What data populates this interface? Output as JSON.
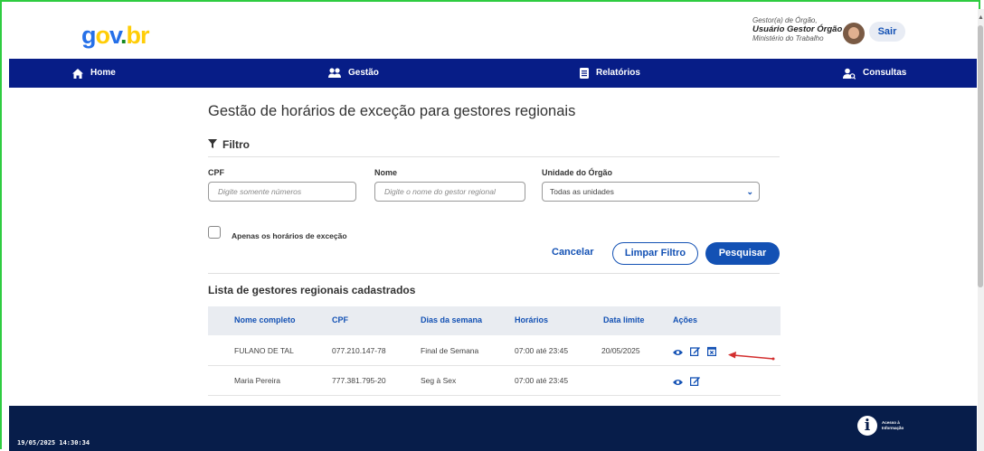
{
  "header": {
    "logo": {
      "g": "g",
      "o": "o",
      "v": "v",
      "dot": ".",
      "br": "br"
    },
    "user": {
      "role": "Gestor(a) de Órgão,",
      "name": "Usuário Gestor Órgão",
      "ministry": "Ministério do Trabalho"
    },
    "logout_label": "Sair"
  },
  "nav": {
    "items": [
      {
        "label": "Home",
        "icon": "home-icon"
      },
      {
        "label": "Gestão",
        "icon": "users-icon"
      },
      {
        "label": "Relatórios",
        "icon": "report-icon"
      },
      {
        "label": "Consultas",
        "icon": "search-user-icon"
      }
    ]
  },
  "page": {
    "title": "Gestão de horários de exceção para gestores regionais"
  },
  "filter": {
    "title": "Filtro",
    "cpf": {
      "label": "CPF",
      "placeholder": "Digite somente números"
    },
    "nome": {
      "label": "Nome",
      "placeholder": "Digite o nome do gestor regional"
    },
    "unidade": {
      "label": "Unidade do Órgão",
      "value": "Todas as unidades"
    },
    "checkbox_label": "Apenas os horários de exceção",
    "cancel_label": "Cancelar",
    "clear_label": "Limpar Filtro",
    "search_label": "Pesquisar"
  },
  "list": {
    "title": "Lista de gestores regionais cadastrados",
    "columns": [
      "Nome completo",
      "CPF",
      "Dias da semana",
      "Horários",
      "Data limite",
      "Ações"
    ],
    "rows": [
      {
        "nome": "FULANO DE TAL",
        "cpf": "077.210.147-78",
        "dias": "Final de Semana",
        "horarios": "07:00 até 23:45",
        "data_limite": "20/05/2025"
      },
      {
        "nome": "Maria Pereira",
        "cpf": "777.381.795-20",
        "dias": "Seg à Sex",
        "horarios": "07:00 até 23:45",
        "data_limite": ""
      }
    ]
  },
  "footer": {
    "timestamp": "19/05/2025 14:30:34",
    "acesso_line1": "Acesso à",
    "acesso_line2": "Informação"
  },
  "colors": {
    "primary": "#1351b4",
    "nav": "#071d87",
    "footer": "#071d4a",
    "frame": "#2ecc40",
    "arrow": "#d32f2f"
  }
}
